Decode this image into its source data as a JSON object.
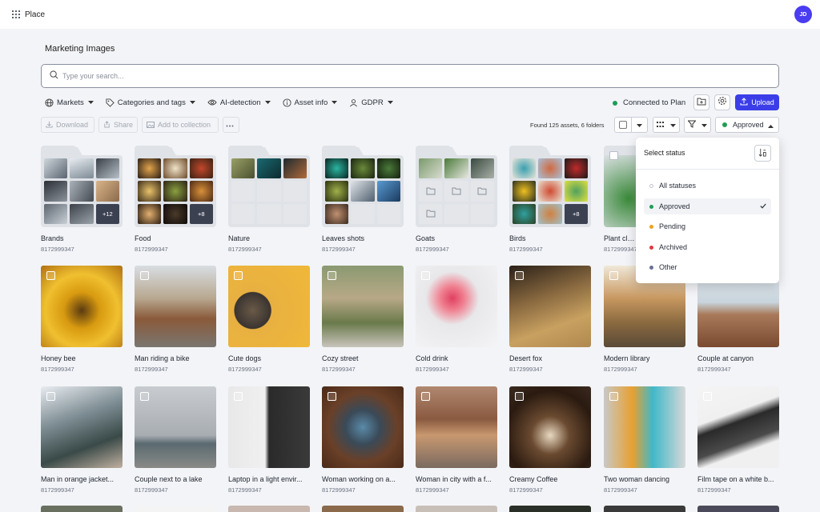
{
  "app": {
    "name": "Place",
    "avatar_initials": "JD"
  },
  "page": {
    "title": "Marketing Images"
  },
  "search": {
    "placeholder": "Type your search..."
  },
  "filters": [
    "Markets",
    "Categories and tags",
    "AI-detection",
    "Asset info",
    "GDPR"
  ],
  "connection": {
    "label": "Connected to Plan",
    "color": "#1f9d55"
  },
  "upload_label": "Upload",
  "actions": {
    "download": "Download",
    "share": "Share",
    "add_to_collection": "Add to collection"
  },
  "found_text": "Found 125 assets, 6 folders",
  "status_filter": {
    "selected": "Approved",
    "title": "Select status",
    "options": [
      {
        "label": "All statuses",
        "color": "#ffffff",
        "selected": false
      },
      {
        "label": "Approved",
        "color": "#1f9d55",
        "selected": true
      },
      {
        "label": "Pending",
        "color": "#f0a020",
        "selected": false
      },
      {
        "label": "Archived",
        "color": "#e0393e",
        "selected": false
      },
      {
        "label": "Other",
        "color": "#6b6f9a",
        "selected": false
      }
    ]
  },
  "folders": [
    {
      "name": "Brands",
      "id": "8172999347",
      "more": "+12"
    },
    {
      "name": "Food",
      "id": "8172999347",
      "more": "+8"
    },
    {
      "name": "Nature",
      "id": "8172999347",
      "more": ""
    },
    {
      "name": "Leaves shots",
      "id": "8172999347",
      "more": ""
    },
    {
      "name": "Goats",
      "id": "8172999347",
      "more": ""
    },
    {
      "name": "Birds",
      "id": "8172999347",
      "more": "+8"
    },
    {
      "name": "Plant close",
      "id": "8172999347",
      "more": ""
    }
  ],
  "assets_row1": [
    {
      "name": "Honey bee",
      "id": "8172999347"
    },
    {
      "name": "Man riding a bike",
      "id": "8172999347"
    },
    {
      "name": "Cute dogs",
      "id": "8172999347"
    },
    {
      "name": "Cozy street",
      "id": "8172999347"
    },
    {
      "name": "Cold drink",
      "id": "8172999347"
    },
    {
      "name": "Desert fox",
      "id": "8172999347"
    },
    {
      "name": "Modern library",
      "id": "8172999347"
    },
    {
      "name": "Couple at canyon",
      "id": "8172999347"
    }
  ],
  "assets_row2": [
    {
      "name": "Man in orange jacket...",
      "id": "8172999347"
    },
    {
      "name": "Couple next to a lake",
      "id": "8172999347"
    },
    {
      "name": "Laptop in a light envir...",
      "id": "8172999347"
    },
    {
      "name": "Woman working on a...",
      "id": "8172999347"
    },
    {
      "name": "Woman in city with a f...",
      "id": "8172999347"
    },
    {
      "name": "Creamy Coffee",
      "id": "8172999347"
    },
    {
      "name": "Two woman dancing",
      "id": "8172999347"
    },
    {
      "name": "Film tape on a white b...",
      "id": "8172999347"
    }
  ],
  "colors": {
    "accent": "#3b3ee8",
    "avatar": "#4a3cf0"
  }
}
